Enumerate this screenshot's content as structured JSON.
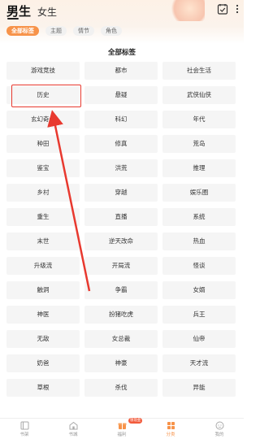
{
  "header": {
    "gender_tabs": [
      {
        "label": "男生",
        "active": true
      },
      {
        "label": "女生",
        "active": false
      }
    ],
    "icons": [
      "checkin-icon",
      "more-icon"
    ]
  },
  "filters": [
    {
      "label": "全部标签",
      "active": true
    },
    {
      "label": "主题",
      "active": false
    },
    {
      "label": "情节",
      "active": false
    },
    {
      "label": "角色",
      "active": false
    }
  ],
  "section_title": "全部标签",
  "tags": [
    "游戏竞技",
    "都市",
    "社会生活",
    "历史",
    "悬疑",
    "武侠仙侠",
    "玄幻奇幻",
    "科幻",
    "年代",
    "种田",
    "修真",
    "荒岛",
    "鉴宝",
    "洪荒",
    "推理",
    "乡村",
    "穿越",
    "娱乐圈",
    "重生",
    "直播",
    "系统",
    "末世",
    "逆天改命",
    "热血",
    "升级流",
    "开局流",
    "怪谈",
    "触洞",
    "争霸",
    "女婿",
    "神医",
    "扮猪吃虎",
    "兵王",
    "无敌",
    "女总裁",
    "仙帝",
    "奶爸",
    "神豪",
    "天才流",
    "草根",
    "杀伐",
    "异能"
  ],
  "highlighted_tag_index": 3,
  "colors": {
    "accent": "#f7934a",
    "highlight": "#e8392f",
    "tag_bg": "#f5f5f5"
  },
  "tabbar": [
    {
      "label": "书架",
      "icon": "bookshelf-icon",
      "active": false
    },
    {
      "label": "书城",
      "icon": "bookstore-icon",
      "active": false
    },
    {
      "label": "福利",
      "icon": "gift-icon",
      "active": false,
      "badge": "领现金"
    },
    {
      "label": "分类",
      "icon": "category-icon",
      "active": true
    },
    {
      "label": "我的",
      "icon": "profile-icon",
      "active": false
    }
  ]
}
